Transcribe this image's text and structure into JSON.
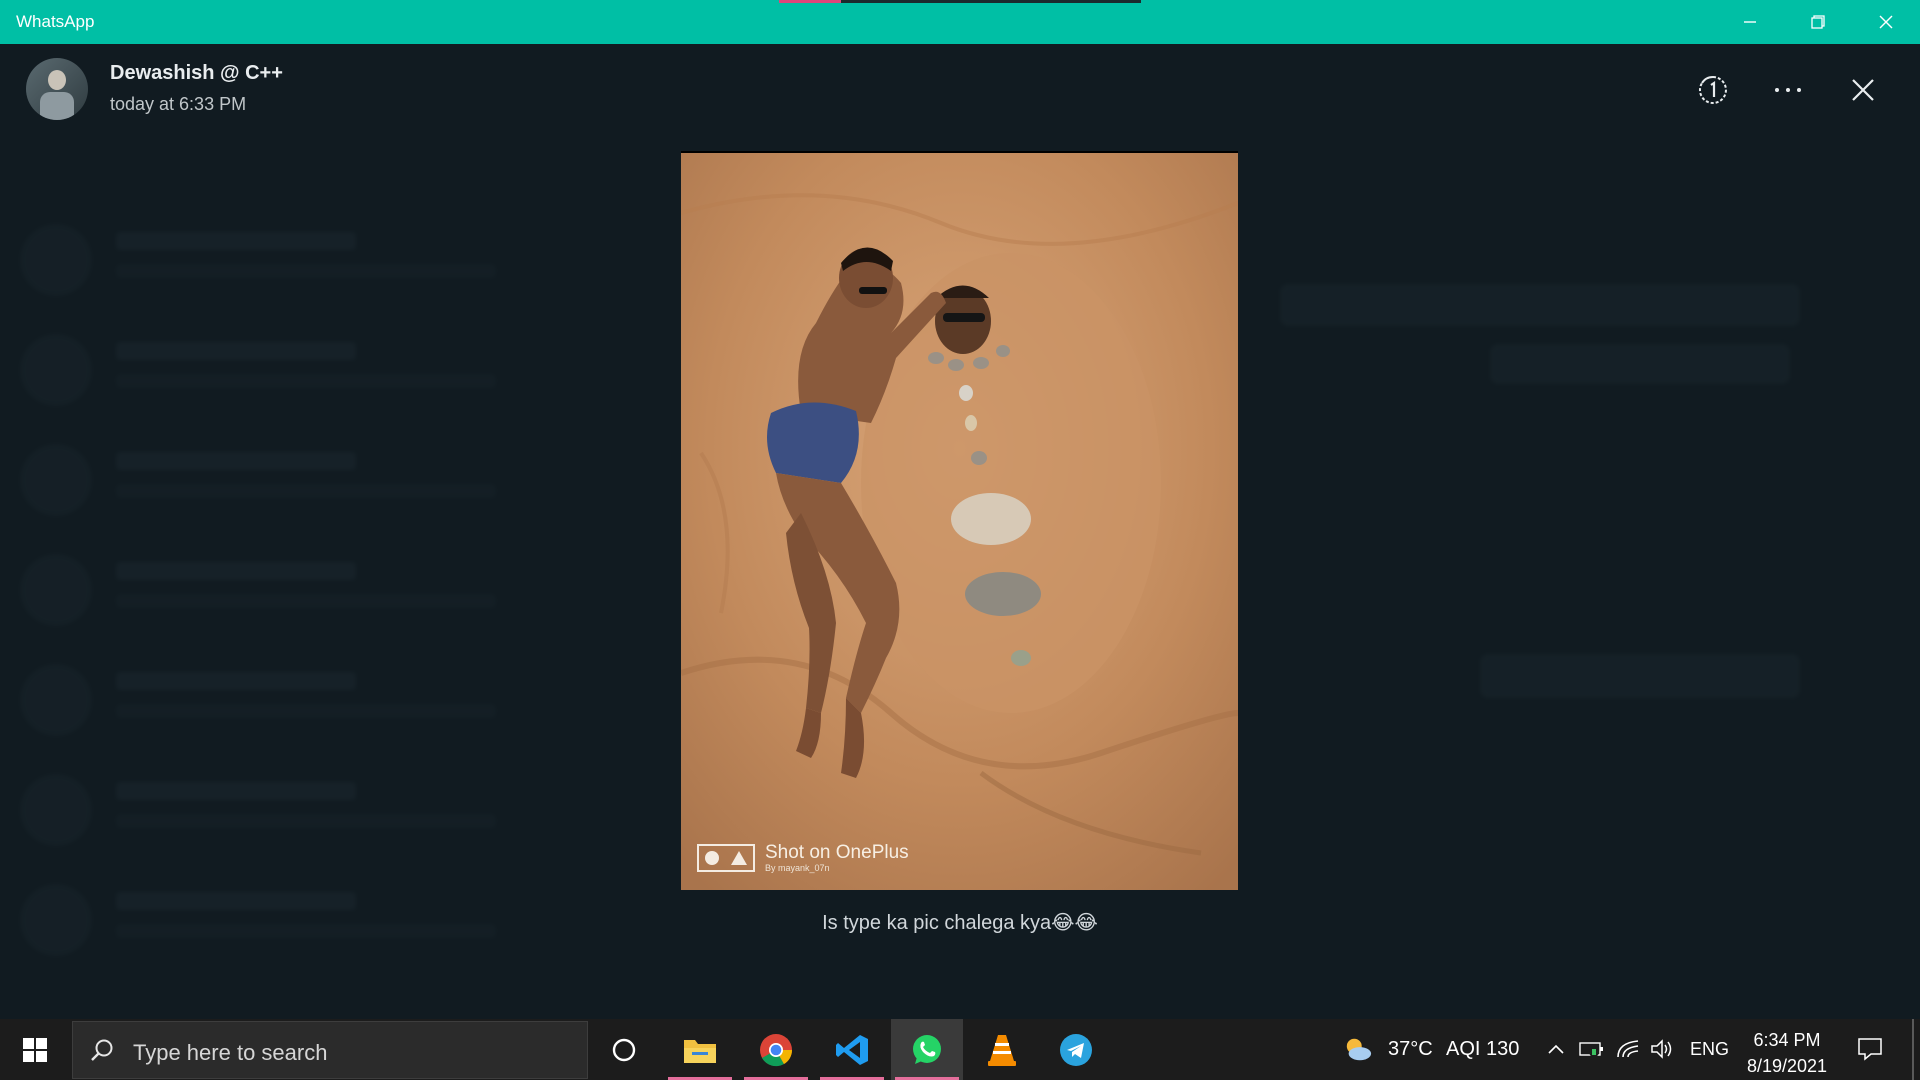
{
  "window": {
    "title": "WhatsApp",
    "load_progress": 0.17
  },
  "viewer": {
    "sender_name": "Dewashish @ C++",
    "timestamp": "today at 6:33 PM",
    "caption": "Is type ka pic chalega kya😂😂",
    "photo_watermark": "Shot on OnePlus",
    "photo_watermark_sub": "By mayank_07n"
  },
  "taskbar": {
    "search_placeholder": "Type here to search",
    "apps": [
      "task-view",
      "file-explorer",
      "chrome",
      "vscode",
      "whatsapp",
      "vlc",
      "telegram"
    ],
    "weather_temp": "37°C",
    "weather_aqi": "AQI 130",
    "language": "ENG",
    "time": "6:34 PM",
    "date": "8/19/2021"
  },
  "colors": {
    "titlebar": "#00bfa5",
    "viewer_bg": "#121b22",
    "taskbar": "#1c1c1c",
    "active_underline": "#e46e9b"
  }
}
